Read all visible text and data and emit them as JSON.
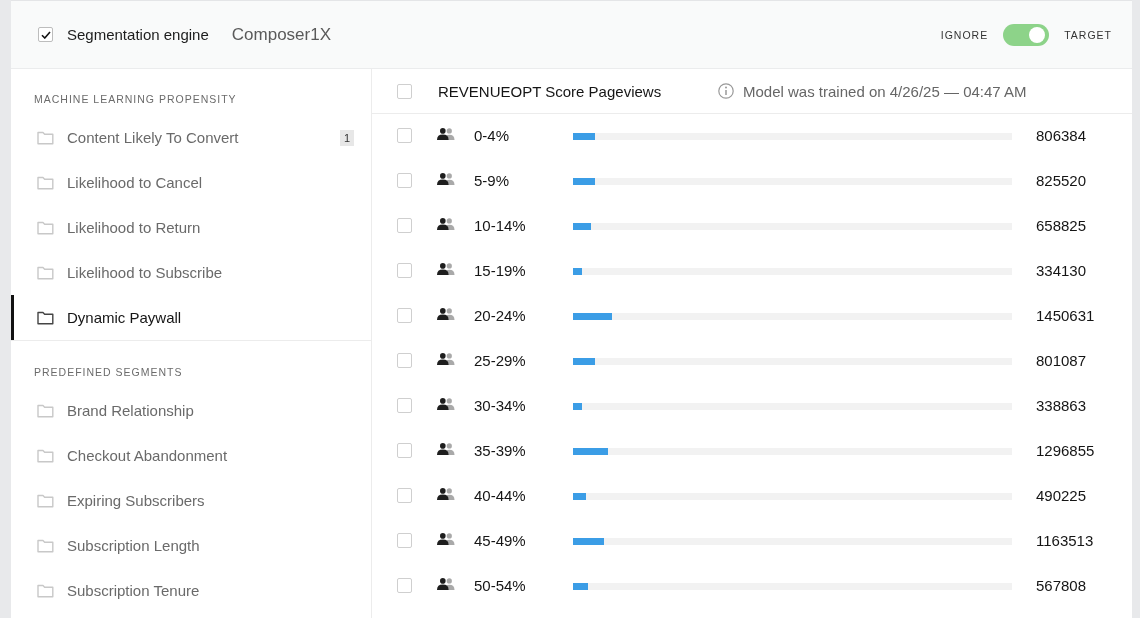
{
  "header": {
    "checked": true,
    "title": "Segmentation engine",
    "subtitle": "Composer1X",
    "toggle": {
      "left_label": "IGNORE",
      "right_label": "TARGET",
      "on": true
    }
  },
  "sidebar": {
    "sections": [
      {
        "heading": "MACHINE LEARNING PROPENSITY",
        "items": [
          {
            "label": "Content Likely To Convert",
            "badge": "1",
            "selected": false
          },
          {
            "label": "Likelihood to Cancel",
            "selected": false
          },
          {
            "label": "Likelihood to Return",
            "selected": false
          },
          {
            "label": "Likelihood to Subscribe",
            "selected": false
          },
          {
            "label": "Dynamic Paywall",
            "selected": true
          }
        ]
      },
      {
        "heading": "PREDEFINED SEGMENTS",
        "items": [
          {
            "label": "Brand Relationship",
            "selected": false
          },
          {
            "label": "Checkout Abandonment",
            "selected": false
          },
          {
            "label": "Expiring Subscribers",
            "selected": false
          },
          {
            "label": "Subscription Length",
            "selected": false
          },
          {
            "label": "Subscription Tenure",
            "selected": false
          }
        ]
      }
    ]
  },
  "main": {
    "header": {
      "checked": false,
      "title": "REVENUEOPT Score Pageviews",
      "info": "Model was trained on 4/26/25 — 04:47 AM"
    },
    "rows": [
      {
        "checked": false,
        "label": "0-4%",
        "level": 0.049,
        "value": "806384"
      },
      {
        "checked": false,
        "label": "5-9%",
        "level": 0.051,
        "value": "825520"
      },
      {
        "checked": false,
        "label": "10-14%",
        "level": 0.04,
        "value": "658825"
      },
      {
        "checked": false,
        "label": "15-19%",
        "level": 0.021,
        "value": "334130"
      },
      {
        "checked": false,
        "label": "20-24%",
        "level": 0.089,
        "value": "1450631"
      },
      {
        "checked": false,
        "label": "25-29%",
        "level": 0.049,
        "value": "801087"
      },
      {
        "checked": false,
        "label": "30-34%",
        "level": 0.021,
        "value": "338863"
      },
      {
        "checked": false,
        "label": "35-39%",
        "level": 0.08,
        "value": "1296855"
      },
      {
        "checked": false,
        "label": "40-44%",
        "level": 0.03,
        "value": "490225"
      },
      {
        "checked": false,
        "label": "45-49%",
        "level": 0.071,
        "value": "1163513"
      },
      {
        "checked": false,
        "label": "50-54%",
        "level": 0.035,
        "value": "567808"
      }
    ]
  }
}
